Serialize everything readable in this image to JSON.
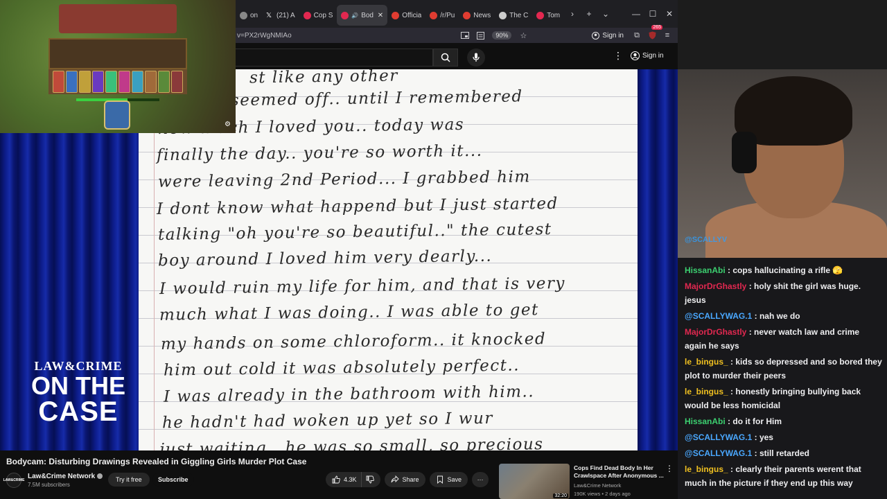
{
  "browser": {
    "tabs": [
      {
        "label": "on",
        "color": "#888888"
      },
      {
        "label": "(21) A",
        "color": "#ffffff",
        "icon": "x-icon"
      },
      {
        "label": "Cop S",
        "color": "#e22850"
      },
      {
        "label": "Bod",
        "color": "#e22850",
        "active": true
      },
      {
        "label": "Officia",
        "color": "#e03c31"
      },
      {
        "label": "/r/Pu",
        "color": "#e03c31"
      },
      {
        "label": "News",
        "color": "#e03c31"
      },
      {
        "label": "The C",
        "color": "#cccccc"
      },
      {
        "label": "Tom",
        "color": "#e22850"
      }
    ],
    "url": "v=PX2rWgNMIAo",
    "zoom": "90%",
    "signin": "Sign in",
    "badge": "265"
  },
  "youtube": {
    "search_value": "",
    "search_placeholder": "",
    "signin": "Sign in"
  },
  "video": {
    "handwriting": [
      "st like any other",
      "nothing seemed off.. until I remembered",
      "how much I loved you.. today was",
      "finally the day.. you're so worth it...",
      "were leaving 2nd Period... I grabbed him",
      "I dont know what happend but I just started",
      "talking \"oh you're so beautiful..\" the cutest",
      "boy around I loved him very dearly...",
      "I would ruin my life for him, and that is very",
      "much what I was doing.. I was able to get",
      "my hands on some chloroform.. it knocked",
      "him out cold it was absolutely perfect..",
      "I was already in the bathroom with him..",
      "he hadn't had woken up yet so I wur",
      "just waiting.. he was so small, so precious"
    ],
    "brand_top": "LAW&CRIME",
    "brand_mid": "ON THE",
    "brand_bot": "CASE"
  },
  "details": {
    "title": "Bodycam: Disturbing Drawings Revealed in Giggling Girls Murder Plot Case",
    "channel": "Law&Crime Network",
    "avatar_text": "LAW&CRIME",
    "subscribers": "7.5M subscribers",
    "try_free": "Try it free",
    "subscribe": "Subscribe",
    "likes": "4.3K",
    "share": "Share",
    "save": "Save"
  },
  "recommended": {
    "title": "Cops Find Dead Body In Her Crawlspace After Anonymous ...",
    "channel": "Law&Crime Network",
    "meta": "190K views • 2 days ago",
    "duration": "32:20"
  },
  "game": {
    "health": 0.62
  },
  "webcam": {
    "overlay_text": "@SCALLYV"
  },
  "chat": [
    {
      "user": "HissanAbi",
      "color": "#3cd070",
      "text": "cops hallucinating a rifle 🫣"
    },
    {
      "user": "MajorDrGhastly",
      "color": "#e22850",
      "text": "holy shit the girl was huge. jesus"
    },
    {
      "user": "@SCALLYWAG.1",
      "color": "#4aa8ff",
      "text": "nah we do"
    },
    {
      "user": "MajorDrGhastly",
      "color": "#e22850",
      "text": "never watch law and crime again he says"
    },
    {
      "user": "le_bingus_",
      "color": "#f0c020",
      "text": "kids so depressed and so bored they plot to murder their peers"
    },
    {
      "user": "le_bingus_",
      "color": "#f0c020",
      "text": "honestly bringing bullying back would be less homicidal"
    },
    {
      "user": "HissanAbi",
      "color": "#3cd070",
      "text": "do it for Him"
    },
    {
      "user": "@SCALLYWAG.1",
      "color": "#4aa8ff",
      "text": "yes"
    },
    {
      "user": "@SCALLYWAG.1",
      "color": "#4aa8ff",
      "text": "still retarded"
    },
    {
      "user": "le_bingus_",
      "color": "#f0c020",
      "text": "clearly their parents werent that much in the picture if they end up this way"
    }
  ]
}
